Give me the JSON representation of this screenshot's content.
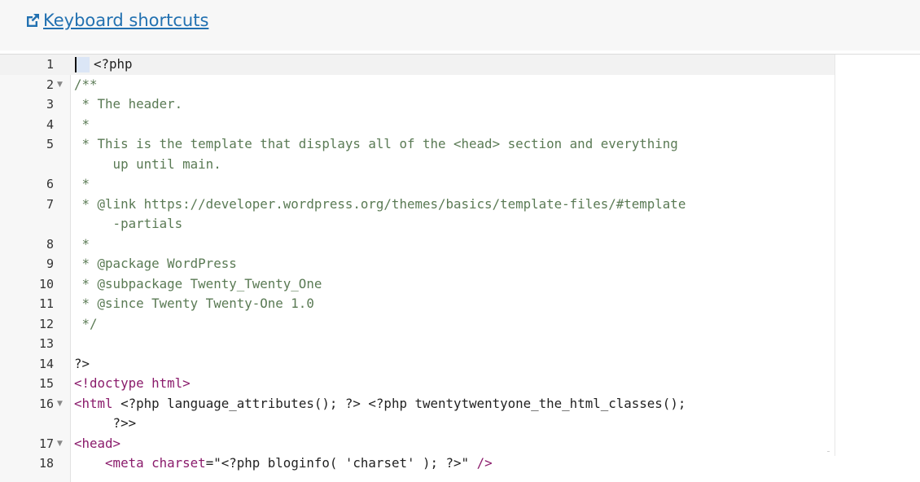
{
  "header": {
    "shortcuts_link": "Keyboard shortcuts"
  },
  "editor": {
    "lines": [
      {
        "n": "1",
        "fold": false,
        "text": "<?php"
      },
      {
        "n": "2",
        "fold": true,
        "text": "/**"
      },
      {
        "n": "3",
        "fold": false,
        "text": " * The header."
      },
      {
        "n": "4",
        "fold": false,
        "text": " *"
      },
      {
        "n": "5",
        "fold": false,
        "text": " * This is the template that displays all of the <head> section and everything",
        "cont": "     up until main."
      },
      {
        "n": "6",
        "fold": false,
        "text": " *"
      },
      {
        "n": "7",
        "fold": false,
        "text": " * @link https://developer.wordpress.org/themes/basics/template-files/#template",
        "cont": "     -partials"
      },
      {
        "n": "8",
        "fold": false,
        "text": " *"
      },
      {
        "n": "9",
        "fold": false,
        "text": " * @package WordPress"
      },
      {
        "n": "10",
        "fold": false,
        "text": " * @subpackage Twenty_Twenty_One"
      },
      {
        "n": "11",
        "fold": false,
        "text": " * @since Twenty Twenty-One 1.0"
      },
      {
        "n": "12",
        "fold": false,
        "text": " */"
      },
      {
        "n": "13",
        "fold": false,
        "text": ""
      },
      {
        "n": "14",
        "fold": false,
        "text": "?>"
      },
      {
        "n": "15",
        "fold": false,
        "text": "<!doctype html>"
      },
      {
        "n": "16",
        "fold": true,
        "text": "<html <?php language_attributes(); ?> <?php twentytwentyone_the_html_classes();",
        "cont": "     ?>>"
      },
      {
        "n": "17",
        "fold": true,
        "text": "<head>"
      },
      {
        "n": "18",
        "fold": false,
        "text": "    <meta charset=\"<?php bloginfo( 'charset' ); ?>\" />"
      }
    ]
  }
}
